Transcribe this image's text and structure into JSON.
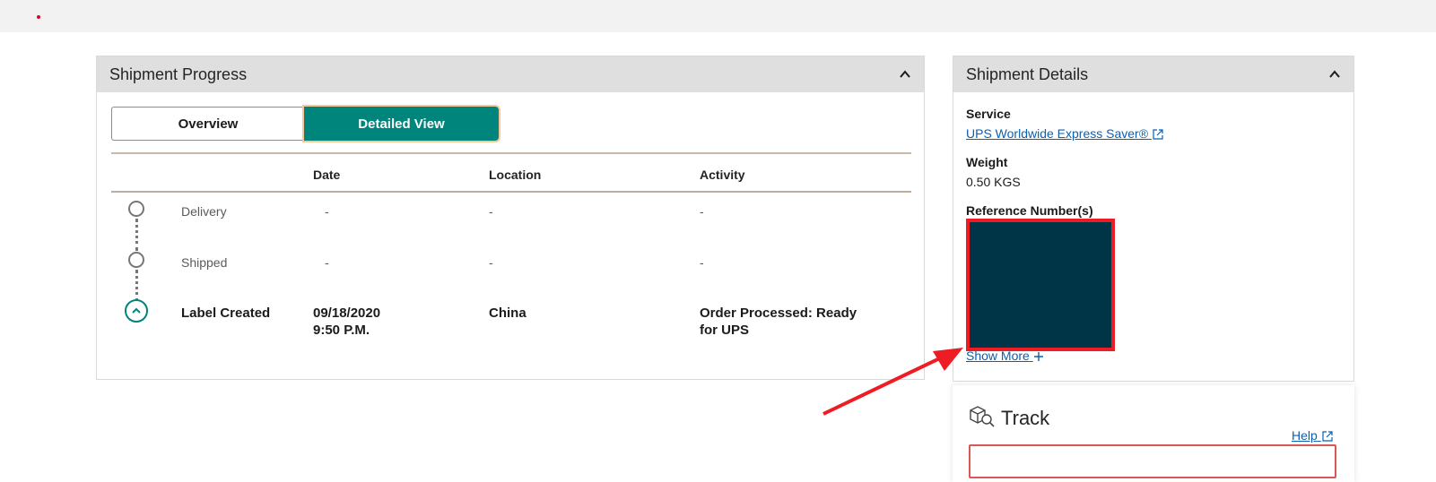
{
  "progress": {
    "title": "Shipment Progress",
    "toggle": {
      "overview": "Overview",
      "detailed": "Detailed View"
    },
    "columns": {
      "date": "Date",
      "location": "Location",
      "activity": "Activity"
    },
    "rows": [
      {
        "status": "Delivery",
        "date": "-",
        "location": "-",
        "activity": "-"
      },
      {
        "status": "Shipped",
        "date": "-",
        "location": "-",
        "activity": "-"
      },
      {
        "status": "Label Created",
        "date_line1": "09/18/2020",
        "date_line2": "9:50 P.M.",
        "location": "China",
        "activity_line1": "Order Processed: Ready",
        "activity_line2": "for UPS"
      }
    ]
  },
  "details": {
    "title": "Shipment Details",
    "service_label": "Service",
    "service_value": "UPS Worldwide Express Saver®",
    "weight_label": "Weight",
    "weight_value": "0.50 KGS",
    "reference_label": "Reference Number(s)",
    "show_more": "Show More"
  },
  "track": {
    "title": "Track",
    "help": "Help",
    "input_value": ""
  },
  "colors": {
    "accent": "#00857d",
    "link": "#0b5fb0",
    "annotation": "#ee1c25",
    "redaction": "#003447"
  }
}
